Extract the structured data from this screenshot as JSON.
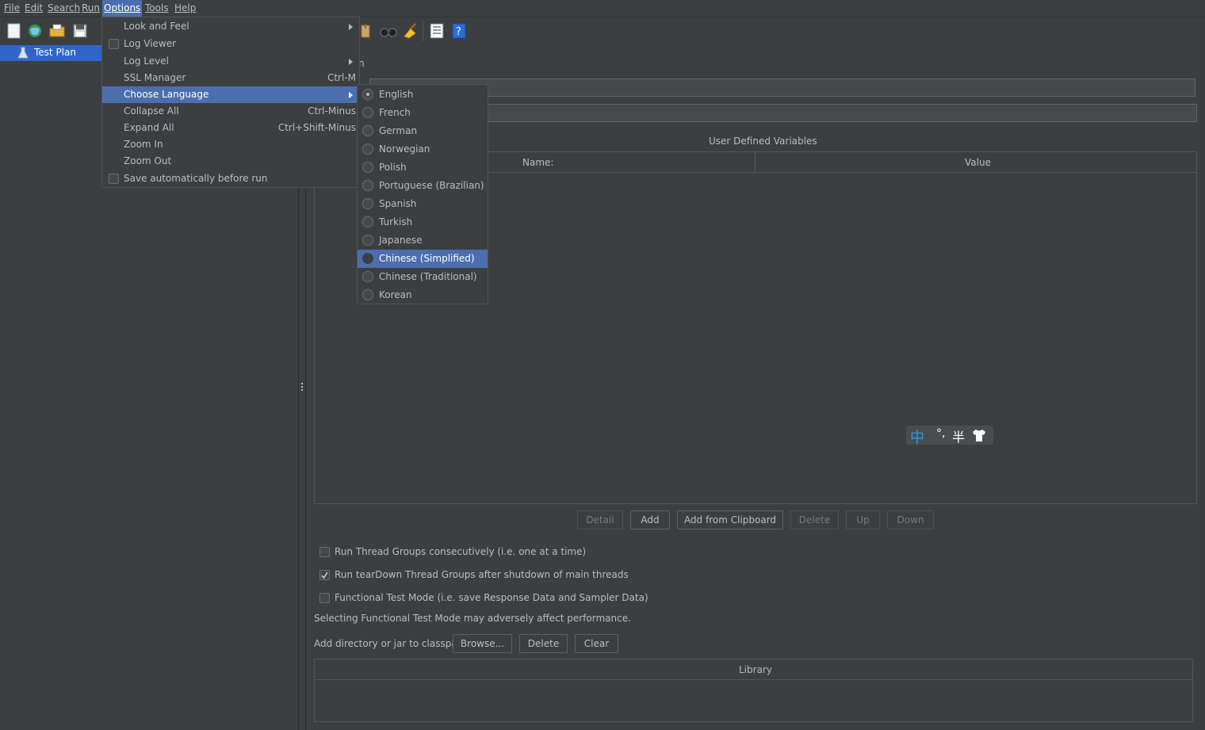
{
  "menubar": {
    "items": [
      "File",
      "Edit",
      "Search",
      "Run",
      "Options",
      "Tools",
      "Help"
    ]
  },
  "tree": {
    "root_label": "Test Plan"
  },
  "options_menu": {
    "items": [
      {
        "label": "Look and Feel",
        "shortcut": "",
        "submenu": true
      },
      {
        "label": "Log Viewer",
        "shortcut": "",
        "checkbox": true
      },
      {
        "label": "Log Level",
        "shortcut": "",
        "submenu": true
      },
      {
        "label": "SSL Manager",
        "shortcut": "Ctrl-M"
      },
      {
        "label": "Choose Language",
        "shortcut": "",
        "submenu": true
      },
      {
        "label": "Collapse All",
        "shortcut": "Ctrl-Minus"
      },
      {
        "label": "Expand All",
        "shortcut": "Ctrl+Shift-Minus"
      },
      {
        "label": "Zoom In",
        "shortcut": ""
      },
      {
        "label": "Zoom Out",
        "shortcut": ""
      },
      {
        "label": "Save automatically before run",
        "shortcut": "",
        "checkbox": true
      }
    ]
  },
  "language_menu": {
    "items": [
      "English",
      "French",
      "German",
      "Norwegian",
      "Polish",
      "Portuguese (Brazilian)",
      "Spanish",
      "Turkish",
      "Japanese",
      "Chinese (Simplified)",
      "Chinese (Traditional)",
      "Korean"
    ],
    "selected": "English",
    "highlighted": "Chinese (Simplified)"
  },
  "main": {
    "partial_label": "n",
    "udv_title": "User Defined Variables",
    "udv_columns": [
      "Name:",
      "Value"
    ],
    "buttons": {
      "detail": "Detail",
      "add": "Add",
      "add_clipboard": "Add from Clipboard",
      "delete": "Delete",
      "up": "Up",
      "down": "Down"
    },
    "options": {
      "run_consecutively": "Run Thread Groups consecutively (i.e. one at a time)",
      "run_teardown": "Run tearDown Thread Groups after shutdown of main threads",
      "functional_mode": "Functional Test Mode (i.e. save Response Data and Sampler Data)",
      "functional_note": "Selecting Functional Test Mode may adversely affect performance."
    },
    "checked": {
      "run_consecutively": false,
      "run_teardown": true,
      "functional_mode": false
    },
    "classpath": {
      "label": "Add directory or jar to classpath",
      "browse": "Browse...",
      "delete": "Delete",
      "clear": "Clear",
      "library_header": "Library"
    }
  },
  "ime_toolbar": {
    "mode": "中",
    "punct": "°,",
    "width": "半",
    "icon": "shirt-icon"
  },
  "colors": {
    "bg": "#3c3f41",
    "highlight": "#4b6eaf",
    "tree_selection": "#2f65ca",
    "text": "#bbbbbb"
  }
}
